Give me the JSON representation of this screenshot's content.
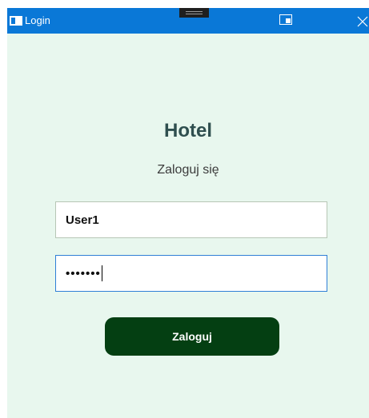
{
  "window": {
    "title": "Login",
    "title_icon": "window-icon",
    "titlebar_color": "#0a78d7",
    "background_color": "#e8f7ee"
  },
  "titlebar_buttons": {
    "snap_icon": "snap-layout-icon",
    "close_icon": "close-icon"
  },
  "content": {
    "heading": "Hotel",
    "subheading": "Zaloguj się"
  },
  "form": {
    "username_value": "User1",
    "password_value": "•••••••",
    "login_label": "Zaloguj",
    "login_button_color": "#043f12"
  }
}
